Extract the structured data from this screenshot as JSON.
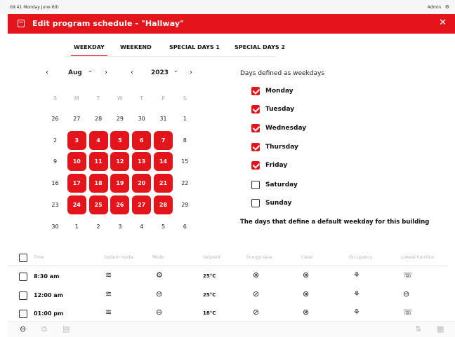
{
  "status": {
    "time": "09:41 Monday June 6th",
    "user": "Admin"
  },
  "window": {
    "title": "Edit program schedule - \"Hallway\"",
    "close": "✕"
  },
  "tabs": [
    "WEEKDAY",
    "WEEKEND",
    "SPECIAL DAYS 1",
    "SPECIAL DAYS 2"
  ],
  "active_tab": "WEEKDAY",
  "calendar": {
    "month": "Aug",
    "year": "2023",
    "nav": {
      "prev": "‹",
      "next": "›",
      "caret": "⌄"
    },
    "weekdays": [
      "S",
      "M",
      "T",
      "W",
      "T",
      "F",
      "S"
    ],
    "weeks": [
      [
        "26",
        "27",
        "28",
        "29",
        "30",
        "31",
        "1"
      ],
      [
        "2",
        "3",
        "4",
        "5",
        "6",
        "7",
        "8"
      ],
      [
        "9",
        "10",
        "11",
        "12",
        "13",
        "14",
        "15"
      ],
      [
        "16",
        "17",
        "18",
        "19",
        "20",
        "21",
        "22"
      ],
      [
        "23",
        "24",
        "25",
        "26",
        "27",
        "28",
        "29"
      ],
      [
        "30",
        "1",
        "2",
        "3",
        "4",
        "5",
        "6"
      ]
    ],
    "selected_days": [
      "3",
      "4",
      "5",
      "6",
      "7",
      "10",
      "11",
      "12",
      "13",
      "14",
      "17",
      "18",
      "19",
      "20",
      "21",
      "24",
      "25",
      "26",
      "27",
      "28"
    ]
  },
  "weekdays_panel": {
    "heading": "Days defined as weekdays",
    "days": [
      {
        "label": "Monday",
        "checked": true
      },
      {
        "label": "Tuesday",
        "checked": true
      },
      {
        "label": "Wednesday",
        "checked": true
      },
      {
        "label": "Thursday",
        "checked": true
      },
      {
        "label": "Friday",
        "checked": true
      },
      {
        "label": "Saturday",
        "checked": false
      },
      {
        "label": "Sunday",
        "checked": false
      }
    ],
    "footnote": "The days that define a default weekday for this building"
  },
  "table": {
    "headers": [
      "Time",
      "System mode",
      "Mode",
      "Setpoint",
      "Energy save",
      "Clean",
      "Occupancy",
      "Lowest function"
    ],
    "rows": [
      {
        "time": "8:30 am",
        "setpoint": "25°C",
        "system_icon": "≋",
        "mode_icon": "⚙",
        "energy_icon": "⊗",
        "clean_icon": "⊗",
        "occupancy_icon": "⚘",
        "lowest_icon": "☏"
      },
      {
        "time": "12:00 am",
        "setpoint": "25°C",
        "system_icon": "≋",
        "mode_icon": "⊖",
        "energy_icon": "⊘",
        "clean_icon": "⊗",
        "occupancy_icon": "⚘",
        "lowest_icon": "⊖"
      },
      {
        "time": "01:00 pm",
        "setpoint": "18°C",
        "system_icon": "≋",
        "mode_icon": "⊖",
        "energy_icon": "⊘",
        "clean_icon": "⊗",
        "occupancy_icon": "⚘",
        "lowest_icon": "☏"
      }
    ]
  },
  "bottom": {
    "remove": "⊖",
    "copy": "⧉",
    "paste": "▤",
    "pages": "⇅",
    "menu": "▦"
  }
}
